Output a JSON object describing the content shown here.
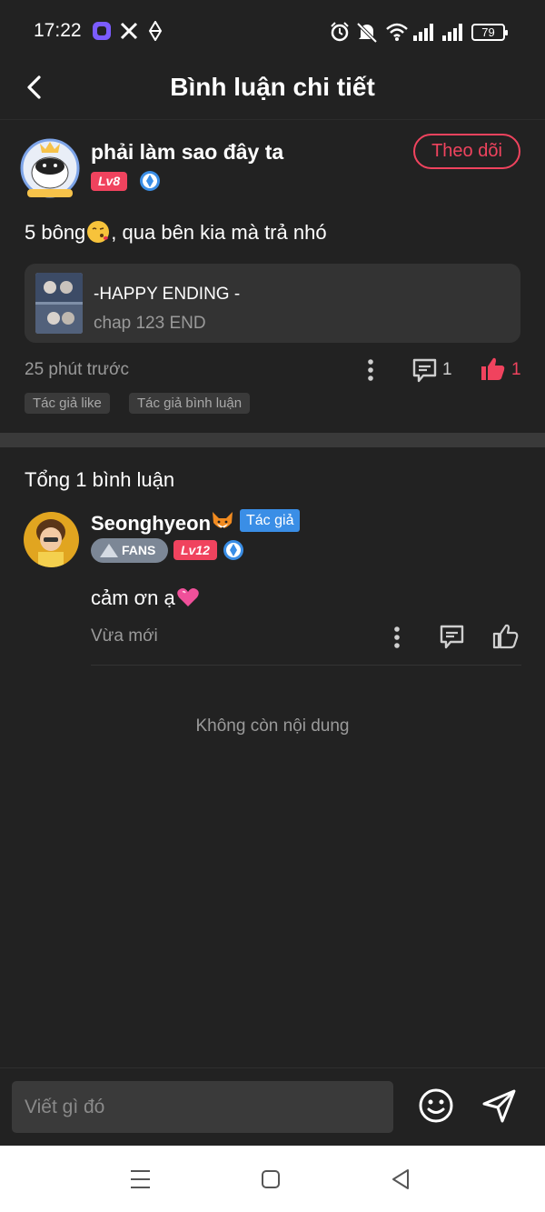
{
  "status_bar": {
    "time": "17:22",
    "battery": "79",
    "icons": [
      "app-icon",
      "x-icon",
      "diamond-icon",
      "alarm-icon",
      "mute-icon",
      "wifi-icon",
      "signal-icon",
      "signal-icon",
      "battery-icon"
    ]
  },
  "header": {
    "title": "Bình luận chi tiết",
    "back_icon": "chevron-left-icon"
  },
  "post": {
    "username": "phải làm sao đây ta",
    "level": "Lv8",
    "follow_label": "Theo dõi",
    "text_before_emoji": "5 bông",
    "emoji": "kissing-face-emoji",
    "text_after_emoji": ", qua bên kia mà trả nhó",
    "linked_story": {
      "title": "-HAPPY ENDING -",
      "chapter": "chap 123 END"
    },
    "time": "25 phút trước",
    "reply_count": "1",
    "like_count": "1",
    "tags": [
      "Tác giả like",
      "Tác giả bình luận"
    ]
  },
  "comments": {
    "total_label": "Tổng 1 bình luận",
    "items": [
      {
        "username": "Seonghyeon",
        "username_emoji": "fox-emoji",
        "author_tag": "Tác giả",
        "fans_label": "FANS",
        "level": "Lv12",
        "text": "cảm ơn ạ",
        "text_emoji": "pink-heart-emoji",
        "time": "Vừa mới"
      }
    ],
    "end_label": "Không còn nội dung"
  },
  "input_bar": {
    "placeholder": "Viết gì đó",
    "emoji_icon": "smiley-icon",
    "send_icon": "send-icon"
  },
  "colors": {
    "background": "#222222",
    "accent": "#f0435e",
    "author_tag": "#3a8ee6",
    "muted_text": "#9a9a9a"
  }
}
